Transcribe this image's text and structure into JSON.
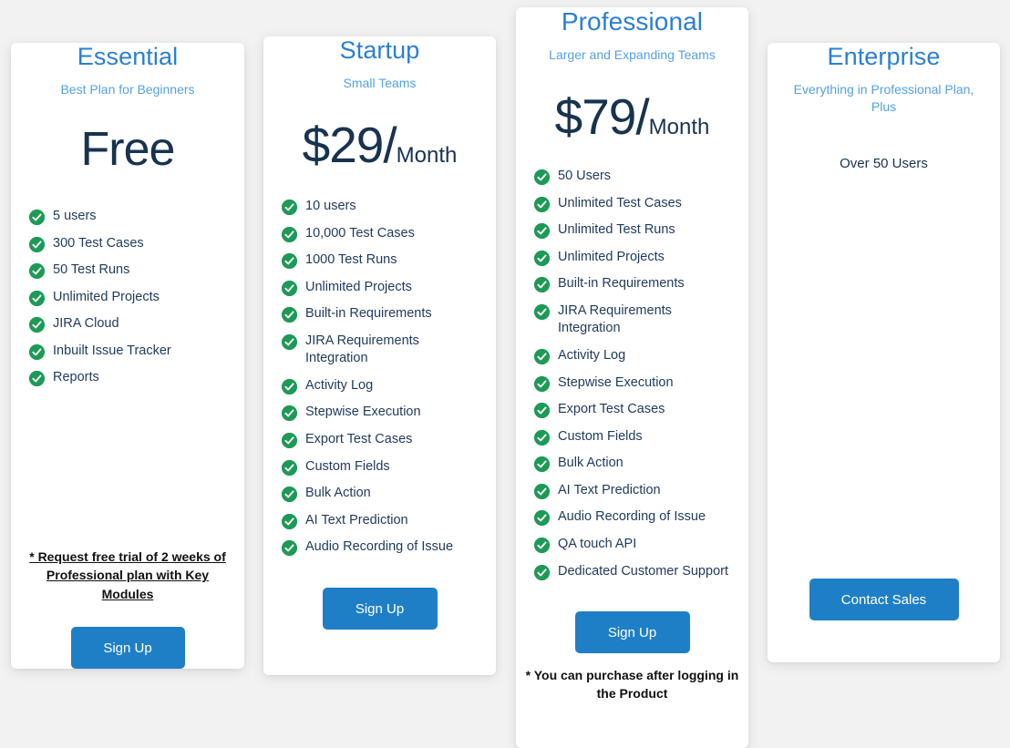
{
  "theme": {
    "page_background": "#f2f2f2",
    "card_background": "#ffffff",
    "plan_name_color": "#2a7fd4",
    "tagline_color": "#54a0e8",
    "price_color": "#17334f",
    "feature_text_color": "#1e3a5c",
    "check_color": "#1d9a56",
    "button_color": "#1f7fc6",
    "note_color": "#111111"
  },
  "plans": [
    {
      "id": "essential",
      "name": "Essential",
      "tagline": "Best Plan for Beginners",
      "price_amount": "Free",
      "price_period": "",
      "features": [
        "5 users",
        "300 Test Cases",
        "50 Test Runs",
        "Unlimited Projects",
        "JIRA Cloud",
        "Inbuilt Issue Tracker",
        "Reports"
      ],
      "note": "* Request free trial of 2 weeks of Professional plan with Key Modules",
      "cta_label": "Sign Up",
      "check_icon": "check-circle-icon"
    },
    {
      "id": "startup",
      "name": "Startup",
      "tagline": "Small Teams",
      "price_amount": "$29/",
      "price_period": "Month",
      "features": [
        "10 users",
        "10,000 Test Cases",
        "1000 Test Runs",
        "Unlimited Projects",
        "Built-in Requirements",
        "JIRA Requirements Integration",
        "Activity Log",
        "Stepwise Execution",
        "Export Test Cases",
        "Custom Fields",
        "Bulk Action",
        "AI Text Prediction",
        "Audio Recording of Issue"
      ],
      "note": "",
      "cta_label": "Sign Up",
      "check_icon": "check-circle-icon"
    },
    {
      "id": "professional",
      "name": "Professional",
      "tagline": "Larger and Expanding Teams",
      "price_amount": "$79/",
      "price_period": "Month",
      "features": [
        "50 Users",
        "Unlimited Test Cases",
        "Unlimited Test Runs",
        "Unlimited Projects",
        "Built-in Requirements",
        "JIRA Requirements Integration",
        "Activity Log",
        "Stepwise Execution",
        "Export Test Cases",
        "Custom Fields",
        "Bulk Action",
        "AI Text Prediction",
        "Audio Recording of Issue",
        "QA touch API",
        "Dedicated Customer Support"
      ],
      "note": "* You can purchase after logging in the Product",
      "cta_label": "Sign Up",
      "check_icon": "check-circle-icon"
    },
    {
      "id": "enterprise",
      "name": "Enterprise",
      "tagline": "Everything in Professional Plan, Plus",
      "price_amount": "",
      "price_period": "",
      "plain_items": [
        "Over 50 Users"
      ],
      "features": [],
      "note": "",
      "cta_label": "Contact Sales",
      "check_icon": "check-circle-icon"
    }
  ]
}
